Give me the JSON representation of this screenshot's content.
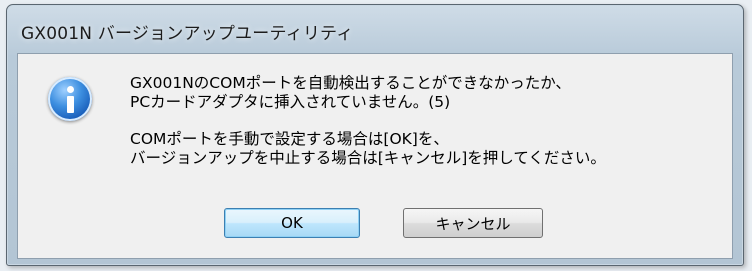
{
  "window": {
    "title": "GX001N バージョンアップユーティリティ"
  },
  "dialog": {
    "icon": "info-icon",
    "message_line1": "GX001NのCOMポートを自動検出することができなかったか、",
    "message_line2": "PCカードアダプタに挿入されていません。(5)",
    "message_line3": "COMポートを手動で設定する場合は[OK]を、",
    "message_line4": "バージョンアップを中止する場合は[キャンセル]を押してください。"
  },
  "buttons": {
    "ok_label": "OK",
    "cancel_label": "キャンセル"
  }
}
